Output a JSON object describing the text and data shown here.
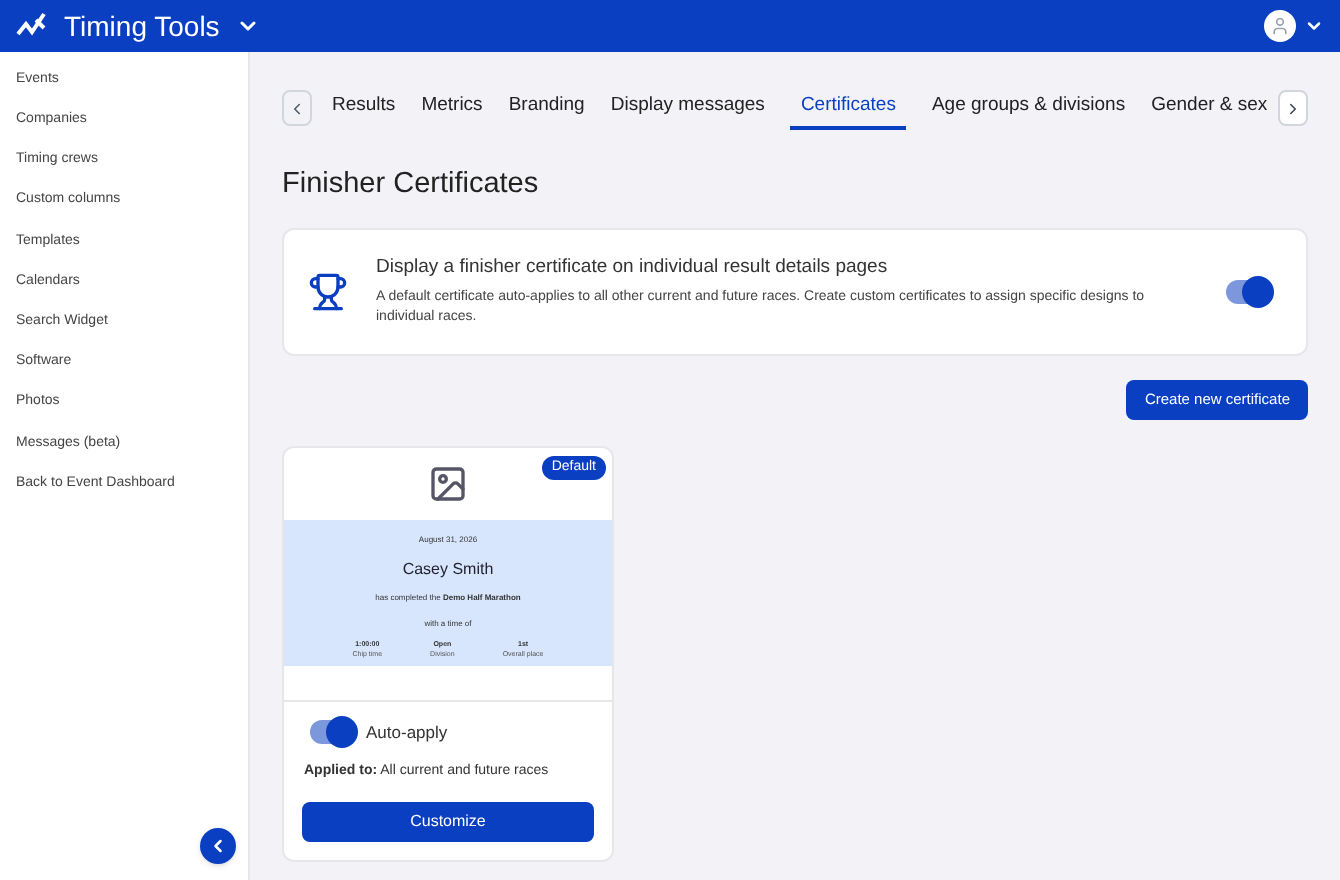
{
  "header": {
    "brand": "Timing Tools"
  },
  "sidebar": {
    "items": [
      "Events",
      "Companies",
      "Timing crews",
      "Custom columns",
      "Templates",
      "Calendars",
      "Search Widget",
      "Software",
      "Photos",
      "Messages (beta)",
      "Back to Event Dashboard"
    ]
  },
  "tabs": [
    {
      "label": "Results",
      "selected": false
    },
    {
      "label": "Metrics",
      "selected": false
    },
    {
      "label": "Branding",
      "selected": false
    },
    {
      "label": "Display messages",
      "selected": false
    },
    {
      "label": "Certificates",
      "selected": true
    },
    {
      "label": "Age groups & divisions",
      "selected": false
    },
    {
      "label": "Gender & sex",
      "selected": false
    }
  ],
  "page_title": "Finisher Certificates",
  "setting": {
    "title": "Display a finisher certificate on individual result details pages",
    "description": "A default certificate auto-applies to all other current and future races. Create custom certificates to assign specific designs to individual races.",
    "on": true
  },
  "create_button": "Create new certificate",
  "certificates": [
    {
      "badge": "Default",
      "preview": {
        "date": "August 31, 2026",
        "name": "Casey Smith",
        "completed": "has completed the **Demo Half Marathon**",
        "time_intro": "with a time of",
        "stats": [
          {
            "value": "1:00:00",
            "label": "Chip time"
          },
          {
            "value": "Open",
            "label": "Division"
          },
          {
            "value": "1st",
            "label": "Overall place"
          }
        ]
      },
      "auto_apply": {
        "label": "Auto-apply",
        "on": true
      },
      "applied_to": "**Applied to:** All current and future races",
      "button": "Customize"
    }
  ]
}
